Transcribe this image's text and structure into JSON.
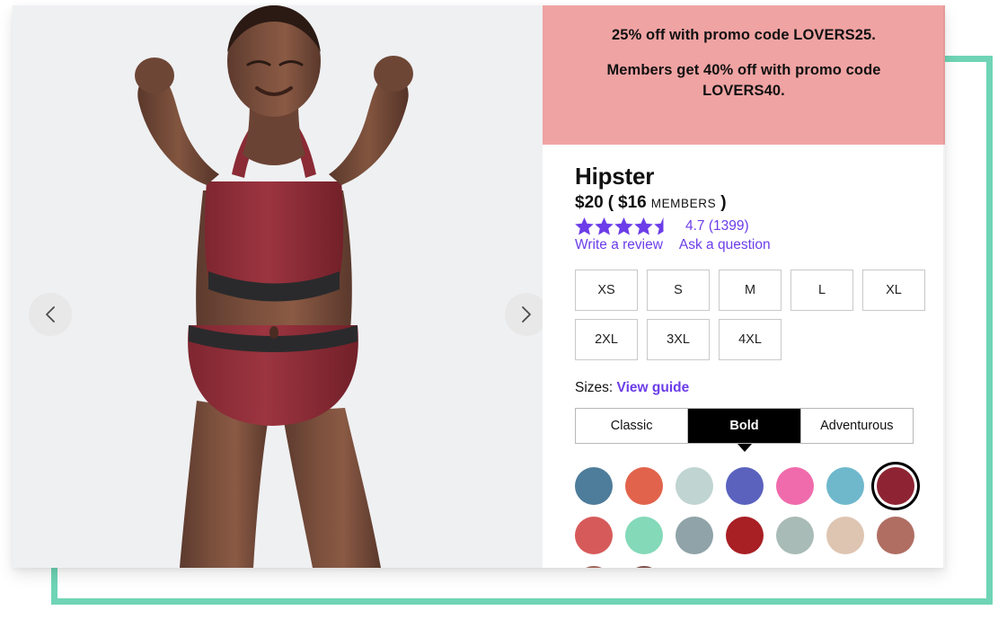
{
  "promo": {
    "line1": "25% off with promo code LOVERS25.",
    "line2": "Members get 40% off with promo code LOVERS40.",
    "bg_color": "#F0A3A3"
  },
  "gallery": {
    "prev_label": "Previous image",
    "next_label": "Next image",
    "background_color": "#EFF0F2",
    "alt": "Model wearing dark red bralette and hipster underwear with black waistbands"
  },
  "product": {
    "title": "Hipster",
    "price": "$20",
    "paren_open": "(",
    "member_price": "$16",
    "member_label": "MEMBERS",
    "paren_close": ")",
    "rating_value": "4.7",
    "rating_count": "(1399)",
    "rating_text": "4.7 (1399)",
    "stars_filled": 4.5,
    "star_color": "#6C3DE8",
    "write_review_label": "Write a review",
    "ask_question_label": "Ask a question",
    "accent_color": "#6C3DE8"
  },
  "sizes": {
    "label": "Sizes:",
    "guide_link": "View guide",
    "options": [
      "XS",
      "S",
      "M",
      "L",
      "XL",
      "2XL",
      "3XL",
      "4XL"
    ],
    "selected": null
  },
  "style_tabs": {
    "items": [
      "Classic",
      "Bold",
      "Adventurous"
    ],
    "selected_index": 1
  },
  "colors": {
    "selected_index": 6,
    "swatches": [
      {
        "name": "steel-blue",
        "hex": "#4E7C9B"
      },
      {
        "name": "coral",
        "hex": "#E2634C"
      },
      {
        "name": "pale-sage",
        "hex": "#C0D4D2"
      },
      {
        "name": "periwinkle",
        "hex": "#5A62BE"
      },
      {
        "name": "hot-pink",
        "hex": "#EF6BAC"
      },
      {
        "name": "light-teal",
        "hex": "#6FB8CC"
      },
      {
        "name": "dark-berry",
        "hex": "#8E2433"
      },
      {
        "name": "rose-red",
        "hex": "#D75A5A"
      },
      {
        "name": "mint",
        "hex": "#84D9B9"
      },
      {
        "name": "blue-gray",
        "hex": "#8FA3A8"
      },
      {
        "name": "brick-red",
        "hex": "#A81F24"
      },
      {
        "name": "gray-green",
        "hex": "#A9BBB6"
      },
      {
        "name": "nude-beige",
        "hex": "#DEC5B2"
      },
      {
        "name": "rosy-brown",
        "hex": "#B06E63"
      },
      {
        "name": "clay-brown",
        "hex": "#9D5F52"
      },
      {
        "name": "dark-cocoa",
        "hex": "#7A4A42"
      }
    ]
  },
  "decor": {
    "frame_color": "#6FD4B5"
  }
}
